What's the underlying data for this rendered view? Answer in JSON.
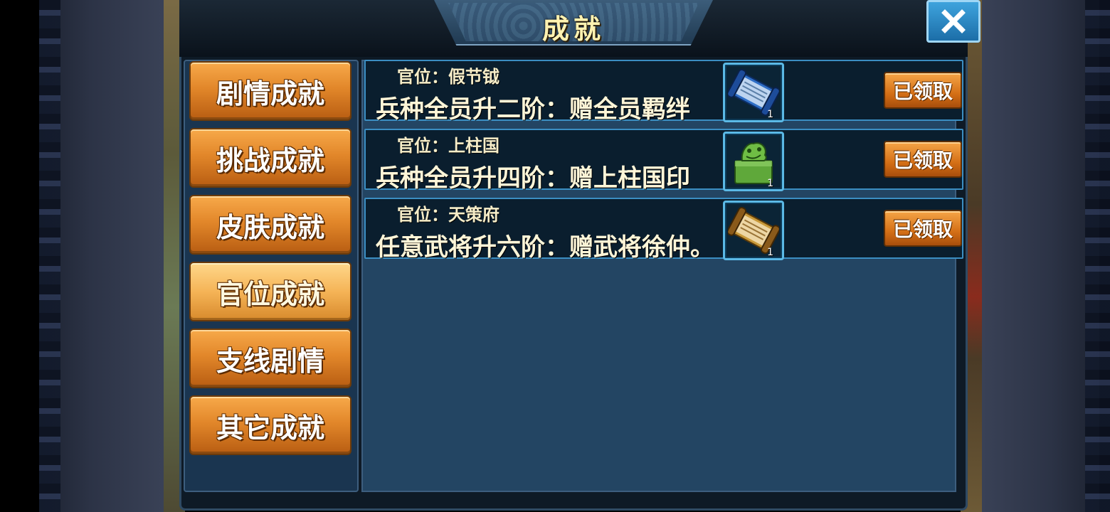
{
  "dialog": {
    "title": "成就",
    "close_icon": "close-icon"
  },
  "tabs": [
    {
      "label": "剧情成就",
      "active": false
    },
    {
      "label": "挑战成就",
      "active": false
    },
    {
      "label": "皮肤成就",
      "active": false
    },
    {
      "label": "官位成就",
      "active": true
    },
    {
      "label": "支线剧情",
      "active": false
    },
    {
      "label": "其它成就",
      "active": false
    }
  ],
  "achievements": [
    {
      "rank": "官位：假节钺",
      "description": "兵种全员升二阶：赠全员羁绊",
      "reward_icon": "blue-scroll-icon",
      "reward_qty": "1",
      "button": "已领取"
    },
    {
      "rank": "官位：上柱国",
      "description": "兵种全员升四阶：赠上柱国印",
      "reward_icon": "jade-seal-icon",
      "reward_qty": "1",
      "button": "已领取"
    },
    {
      "rank": "官位：天策府",
      "description": "任意武将升六阶：赠武将徐仲。",
      "reward_icon": "gold-scroll-icon",
      "reward_qty": "1",
      "button": "已领取"
    }
  ],
  "colors": {
    "accent": "#e2872a",
    "panel": "#234563",
    "row_border": "#3b8ec2"
  }
}
